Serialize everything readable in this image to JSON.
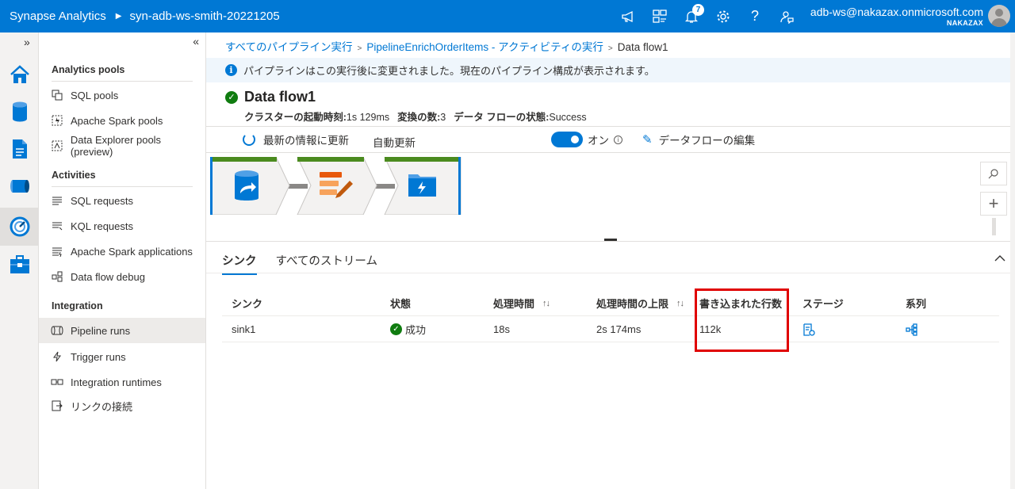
{
  "topbar": {
    "brand": "Synapse Analytics",
    "workspace": "syn-adb-ws-smith-20221205",
    "notification_count": "7",
    "account_email": "adb-ws@nakazax.onmicrosoft.com",
    "account_tenant": "NAKAZAX",
    "icons": [
      "megaphone-icon",
      "directory-icon",
      "bell-icon",
      "gear-icon",
      "help-icon",
      "feedback-icon"
    ]
  },
  "rail": {
    "items": [
      "home-icon",
      "data-icon",
      "develop-icon",
      "integrate-icon",
      "monitor-icon",
      "manage-icon"
    ],
    "active": "monitor-icon"
  },
  "nav": {
    "sections": [
      {
        "title": "Analytics pools",
        "items": [
          {
            "label": "SQL pools",
            "icon": "sql-pools-icon"
          },
          {
            "label": "Apache Spark pools",
            "icon": "spark-pools-icon"
          },
          {
            "label": "Data Explorer pools (preview)",
            "icon": "data-explorer-icon"
          }
        ]
      },
      {
        "title": "Activities",
        "items": [
          {
            "label": "SQL requests",
            "icon": "sql-requests-icon"
          },
          {
            "label": "KQL requests",
            "icon": "kql-requests-icon"
          },
          {
            "label": "Apache Spark applications",
            "icon": "spark-apps-icon"
          },
          {
            "label": "Data flow debug",
            "icon": "dataflow-debug-icon"
          }
        ]
      },
      {
        "title": "Integration",
        "items": [
          {
            "label": "Pipeline runs",
            "icon": "pipeline-runs-icon",
            "active": true
          },
          {
            "label": "Trigger runs",
            "icon": "trigger-runs-icon"
          },
          {
            "label": "Integration runtimes",
            "icon": "integration-runtimes-icon"
          },
          {
            "label": "リンクの接続",
            "icon": "link-connections-icon"
          }
        ]
      }
    ]
  },
  "breadcrumb": {
    "items": [
      "すべてのパイプライン実行",
      "PipelineEnrichOrderItems - アクティビティの実行"
    ],
    "current": "Data flow1"
  },
  "banner": {
    "text": "パイプラインはこの実行後に変更されました。現在のパイプライン構成が表示されます。"
  },
  "header": {
    "title": "Data flow1",
    "cluster_label": "クラスターの起動時刻:",
    "cluster_value": "1s 129ms",
    "transform_label": "変換の数:",
    "transform_value": "3",
    "state_label": "データ フローの状態:",
    "state_value": "Success"
  },
  "toolbar": {
    "refresh": "最新の情報に更新",
    "auto_refresh": "自動更新",
    "toggle_label": "オン",
    "toggle_on": true,
    "edit": "データフローの編集"
  },
  "flow": {
    "nodes": [
      "source-node-icon",
      "transform-node-icon",
      "sink-node-icon"
    ]
  },
  "tabs": [
    {
      "label": "シンク",
      "active": true
    },
    {
      "label": "すべてのストリーム",
      "active": false
    }
  ],
  "table": {
    "columns": [
      "シンク",
      "状態",
      "処理時間",
      "処理時間の上限",
      "書き込まれた行数",
      "ステージ",
      "系列"
    ],
    "rows": [
      {
        "sink": "sink1",
        "status": "成功",
        "processing_time": "18s",
        "processing_time_max": "2s 174ms",
        "rows_written": "112k",
        "stage_icon": "stage-details-icon",
        "lineage_icon": "lineage-icon"
      }
    ]
  },
  "colors": {
    "accent": "#0078d4",
    "success": "#107c10",
    "highlight": "#e00000",
    "banner_bg": "#eff6fc",
    "flow_header": "#4b8b1f"
  }
}
